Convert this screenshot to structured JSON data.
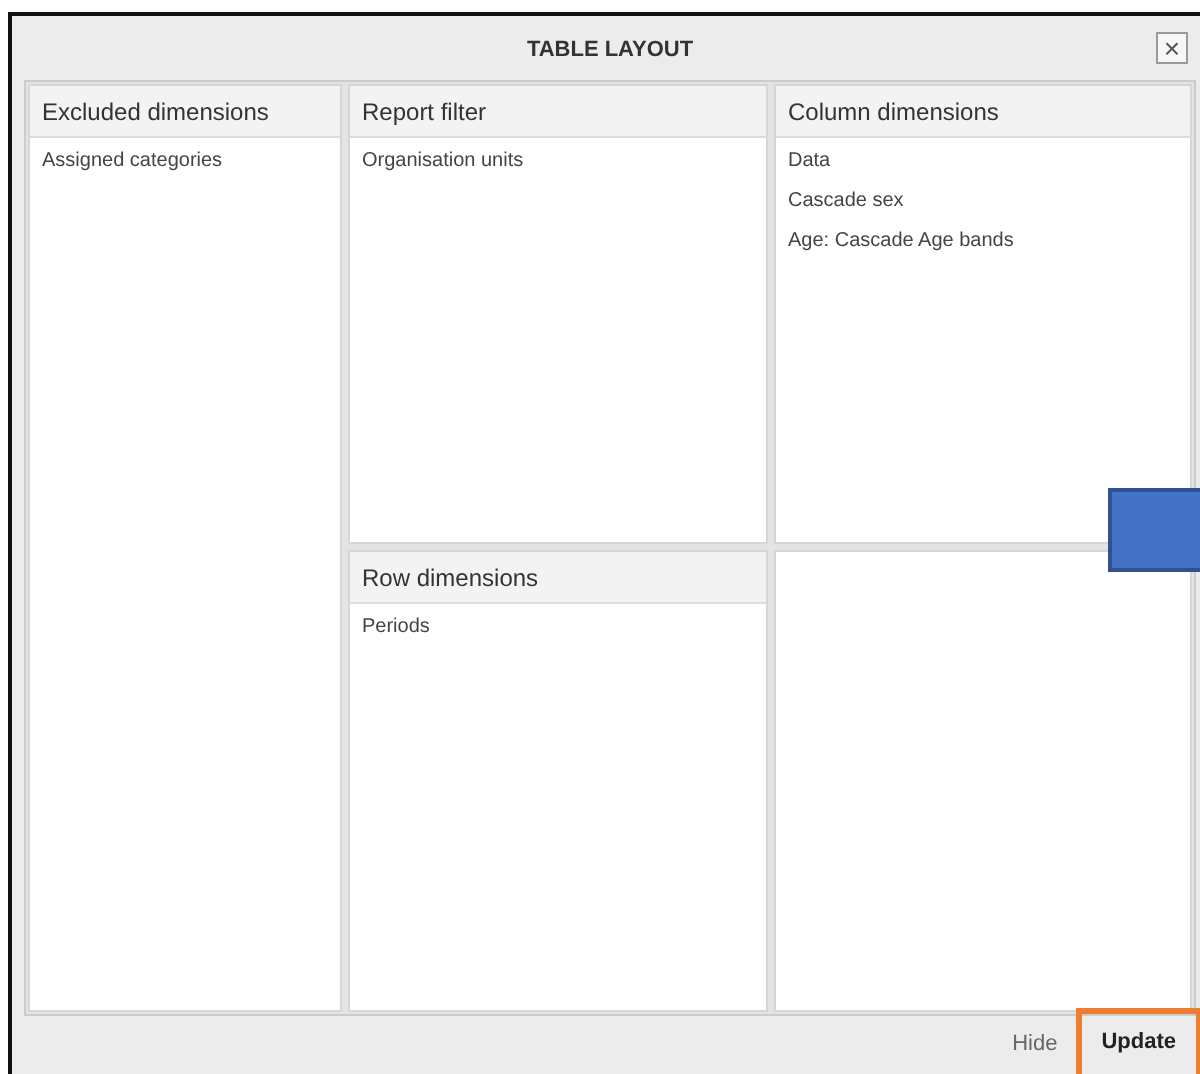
{
  "window": {
    "title": "TABLE LAYOUT",
    "close": "×"
  },
  "panels": [
    {
      "kind": "excluded",
      "title": "Excluded dimensions",
      "items": [
        "Assigned categories"
      ]
    },
    {
      "kind": "filter",
      "title": "Report filter",
      "items": [
        "Organisation units"
      ]
    },
    {
      "kind": "columns",
      "title": "Column dimensions",
      "items": [
        "Data",
        "Cascade sex",
        "Age: Cascade Age bands"
      ]
    },
    {
      "kind": "rows",
      "title": "Row dimensions",
      "items": [
        "Periods"
      ]
    }
  ],
  "footer": {
    "buttons": [
      {
        "label": "Hide",
        "highlighted": false
      },
      {
        "label": "Update",
        "highlighted": true
      }
    ]
  }
}
